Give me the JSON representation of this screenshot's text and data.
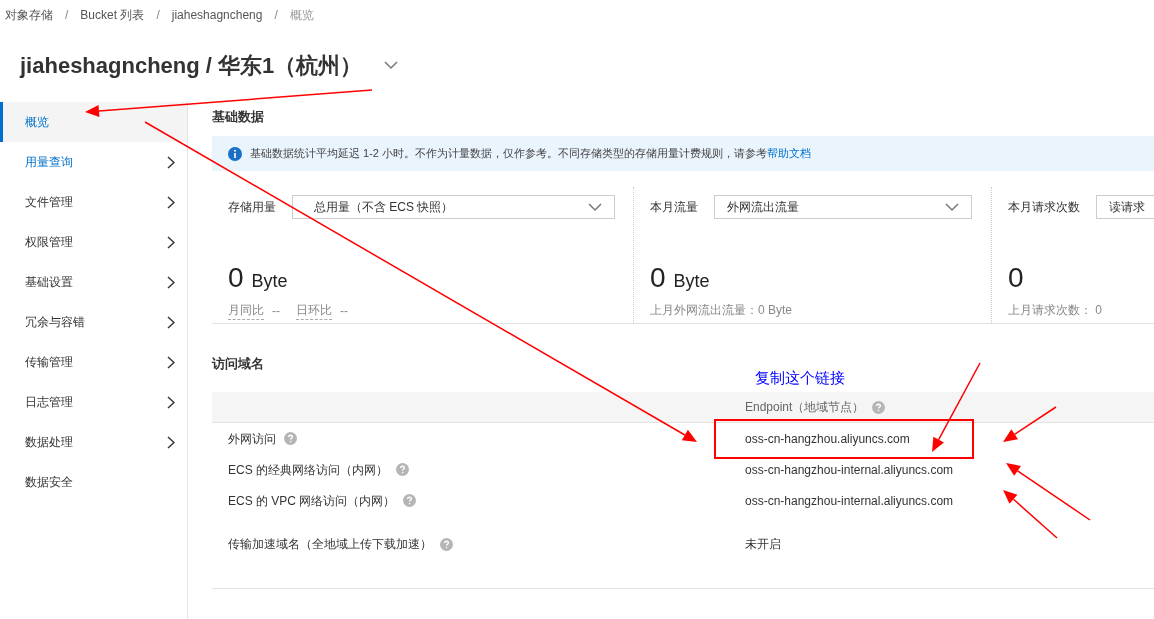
{
  "breadcrumb": [
    {
      "text": "对象存储",
      "kind": "crumb"
    },
    {
      "text": "/",
      "kind": "separator"
    },
    {
      "text": "Bucket 列表",
      "kind": "crumb"
    },
    {
      "text": "/",
      "kind": "separator"
    },
    {
      "text": "jiaheshagncheng",
      "kind": "crumb"
    },
    {
      "text": "/",
      "kind": "separator"
    },
    {
      "text": "概览",
      "kind": "current"
    }
  ],
  "title": "jiaheshagncheng / 华东1（杭州）",
  "sidebar": {
    "items": [
      {
        "label": "概览",
        "selected": true,
        "highlighted": false,
        "expandable": false
      },
      {
        "label": "用量查询",
        "selected": false,
        "highlighted": true,
        "expandable": true
      },
      {
        "label": "文件管理",
        "selected": false,
        "highlighted": false,
        "expandable": true
      },
      {
        "label": "权限管理",
        "selected": false,
        "highlighted": false,
        "expandable": true
      },
      {
        "label": "基础设置",
        "selected": false,
        "highlighted": false,
        "expandable": true
      },
      {
        "label": "冗余与容错",
        "selected": false,
        "highlighted": false,
        "expandable": true
      },
      {
        "label": "传输管理",
        "selected": false,
        "highlighted": false,
        "expandable": true
      },
      {
        "label": "日志管理",
        "selected": false,
        "highlighted": false,
        "expandable": true
      },
      {
        "label": "数据处理",
        "selected": false,
        "highlighted": false,
        "expandable": true
      },
      {
        "label": "数据安全",
        "selected": false,
        "highlighted": false,
        "expandable": false
      }
    ]
  },
  "basic_data": {
    "heading": "基础数据",
    "notice": {
      "text": "基础数据统计平均延迟 1-2 小时。不作为计量数据，仅作参考。不同存储类型的存储用量计费规则，请参考",
      "link": "帮助文档"
    },
    "metrics": [
      {
        "label": "存储用量",
        "select": "总用量（不含 ECS 快照）",
        "value": "0",
        "unit": "Byte",
        "compare": [
          {
            "label": "月同比",
            "value": "--"
          },
          {
            "label": "日环比",
            "value": "--"
          }
        ]
      },
      {
        "label": "本月流量",
        "select": "外网流出流量",
        "value": "0",
        "unit": "Byte",
        "note": "上月外网流出流量：0 Byte"
      },
      {
        "label": "本月请求次数",
        "select": "读请求",
        "value": "0",
        "note": "上月请求次数： 0"
      }
    ]
  },
  "domains": {
    "heading": "访问域名",
    "annotation": "复制这个链接",
    "column_header": "Endpoint（地域节点）",
    "rows": [
      {
        "label": "外网访问",
        "value": "oss-cn-hangzhou.aliyuncs.com",
        "boxed": true
      },
      {
        "label": "ECS 的经典网络访问（内网）",
        "value": "oss-cn-hangzhou-internal.aliyuncs.com",
        "boxed": false
      },
      {
        "label": "ECS 的 VPC 网络访问（内网）",
        "value": "oss-cn-hangzhou-internal.aliyuncs.com",
        "boxed": false
      },
      {
        "label": "传输加速域名（全地域上传下载加速）",
        "value": "未开启",
        "boxed": false
      }
    ]
  }
}
